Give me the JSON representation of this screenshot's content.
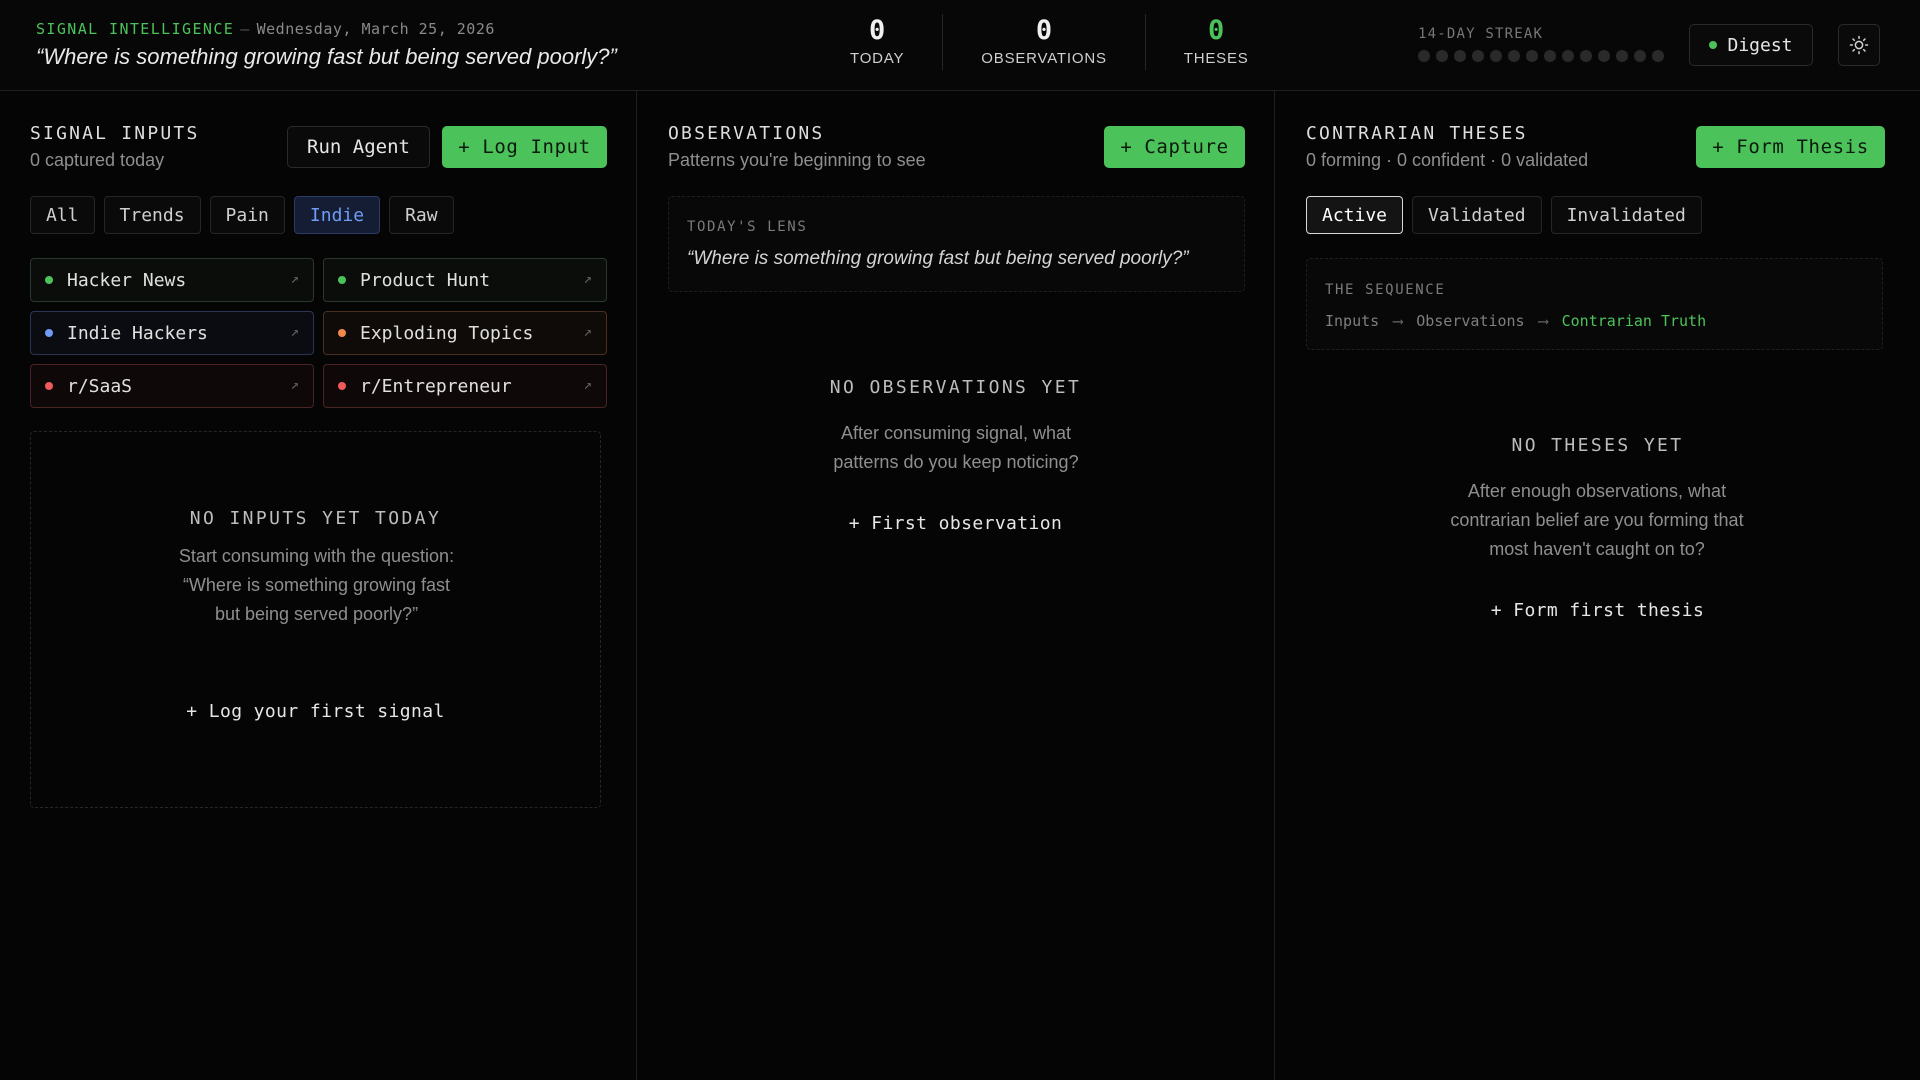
{
  "header": {
    "brand": "SIGNAL INTELLIGENCE",
    "separator": "—",
    "date": "Wednesday, March 25, 2026",
    "question": "“Where is something growing fast but being served poorly?”",
    "stats": [
      {
        "value": "0",
        "label": "TODAY"
      },
      {
        "value": "0",
        "label": "OBSERVATIONS"
      },
      {
        "value": "0",
        "label": "THESES"
      }
    ],
    "streak_label": "14-DAY STREAK",
    "streak_days_completed": 0,
    "streak_days_total": 14,
    "digest_label": "Digest",
    "theme_icon": "sun-icon"
  },
  "inputs": {
    "title": "SIGNAL INPUTS",
    "subtitle": "0 captured today",
    "run_agent_label": "Run Agent",
    "log_input_label": "+ Log Input",
    "filters": [
      "All",
      "Trends",
      "Pain",
      "Indie",
      "Raw"
    ],
    "active_filter": "Indie",
    "sources": [
      {
        "label": "Hacker News",
        "color": "#4cc35a"
      },
      {
        "label": "Product Hunt",
        "color": "#4cc35a"
      },
      {
        "label": "Indie Hackers",
        "color": "#6f9cf5"
      },
      {
        "label": "Exploding Topics",
        "color": "#f08a4b"
      },
      {
        "label": "r/SaaS",
        "color": "#f05a5a"
      },
      {
        "label": "r/Entrepreneur",
        "color": "#f05a5a"
      }
    ],
    "source_arrow": "↗",
    "empty_title": "NO INPUTS YET TODAY",
    "empty_text": "Start consuming with the question: “Where is something growing fast but being served poorly?”",
    "empty_link": "+ Log your first signal"
  },
  "observations": {
    "title": "OBSERVATIONS",
    "subtitle": "Patterns you're beginning to see",
    "capture_label": "+ Capture",
    "lens_label": "TODAY'S LENS",
    "lens_quote": "“Where is something growing fast but being served poorly?”",
    "empty_title": "NO OBSERVATIONS YET",
    "empty_text": "After consuming signal, what patterns do you keep noticing?",
    "empty_link": "+ First observation"
  },
  "theses": {
    "title": "CONTRARIAN THESES",
    "subtitle": "0 forming · 0 confident · 0 validated",
    "form_label": "+ Form Thesis",
    "tabs": [
      "Active",
      "Validated",
      "Invalidated"
    ],
    "active_tab": "Active",
    "sequence_label": "THE SEQUENCE",
    "sequence": [
      "Inputs",
      "Observations",
      "Contrarian Truth"
    ],
    "sequence_arrow": "⟶",
    "empty_title": "NO THESES YET",
    "empty_text": "After enough observations, what contrarian belief are you forming that most haven't caught on to?",
    "empty_link": "+ Form first thesis"
  },
  "colors": {
    "accent_green": "#4cc35a",
    "blue": "#6f9cf5",
    "orange": "#f08a4b",
    "red": "#f05a5a",
    "background": "#050505"
  }
}
